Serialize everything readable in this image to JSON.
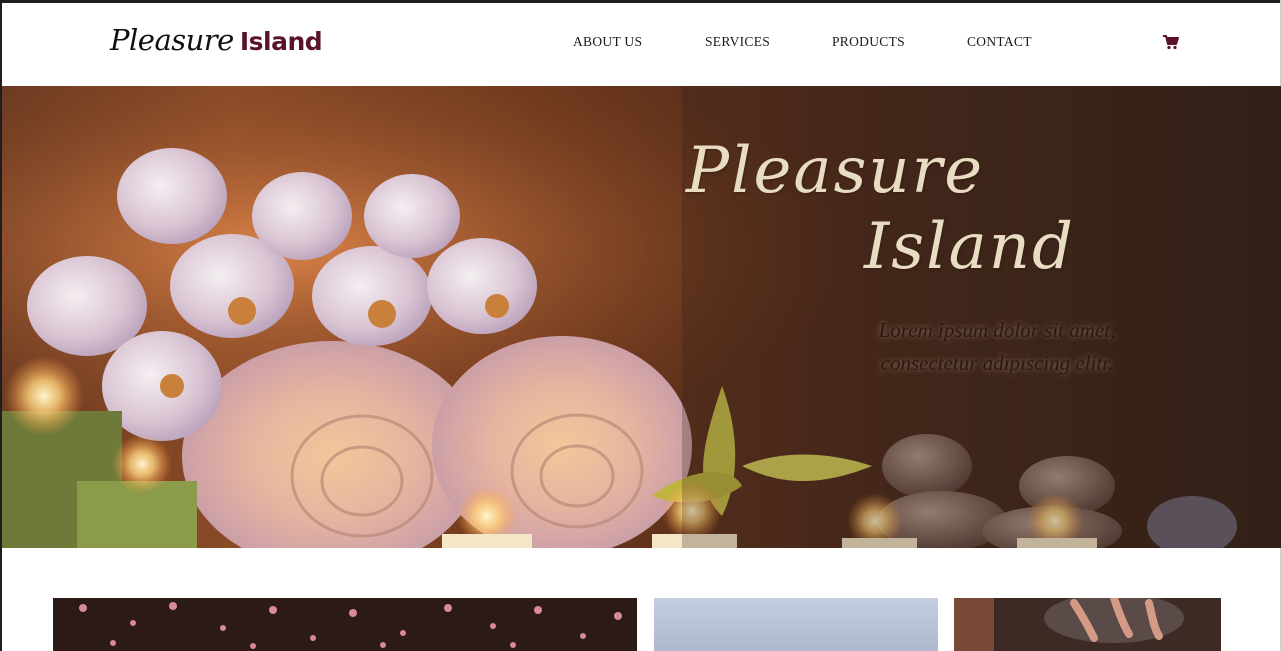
{
  "header": {
    "logo": {
      "script": "Pleasure",
      "bold": "Island"
    },
    "nav": [
      {
        "label": "ABOUT US"
      },
      {
        "label": "SERVICES"
      },
      {
        "label": "PRODUCTS"
      },
      {
        "label": "CONTACT"
      }
    ],
    "cart_icon": "shopping-cart-icon"
  },
  "hero": {
    "title_line1": "Pleasure",
    "title_line2": "Island",
    "subtitle_line1": "Lorem ipsum dolor sit amet,",
    "subtitle_line2": "consectetur adipiscing elitr."
  },
  "colors": {
    "brand": "#5a1428",
    "hero_title": "#e8dcc2",
    "nav_text": "#1a1a1a"
  }
}
